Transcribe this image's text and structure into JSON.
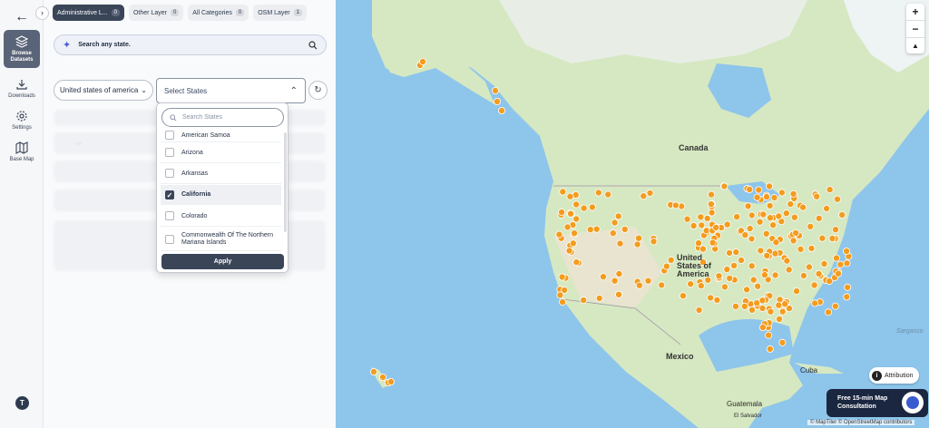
{
  "rail": {
    "back_icon": "arrow-left-icon",
    "items": [
      {
        "label": "Browse Datasets",
        "icon": "layers-icon",
        "active": true
      },
      {
        "label": "Downloads",
        "icon": "download-icon"
      },
      {
        "label": "Settings",
        "icon": "gear-icon"
      },
      {
        "label": "Base Map",
        "icon": "map-icon"
      }
    ],
    "avatar_initial": "T"
  },
  "tabs": [
    {
      "label": "Administrative L...",
      "count": "0",
      "active": true
    },
    {
      "label": "Other Layer",
      "count": "0"
    },
    {
      "label": "All Categories",
      "count": "0"
    },
    {
      "label": "OSM Layer",
      "count": "1"
    }
  ],
  "search": {
    "placeholder": "Search any state."
  },
  "filters": {
    "country": "United states of america",
    "states_placeholder": "Select States"
  },
  "dropdown": {
    "search_placeholder": "Search States",
    "items": [
      {
        "label": "American Samoa",
        "checked": false
      },
      {
        "label": "Arizona",
        "checked": false
      },
      {
        "label": "Arkansas",
        "checked": false
      },
      {
        "label": "California",
        "checked": true
      },
      {
        "label": "Colorado",
        "checked": false
      },
      {
        "label": "Commonwealth Of The Northern Mariana Islands",
        "checked": false
      }
    ],
    "apply_label": "Apply"
  },
  "map": {
    "labels": {
      "canada": "Canada",
      "usa": "United States of America",
      "mexico": "Mexico",
      "cuba": "Cuba",
      "guatemala": "Guatemala",
      "el_salvador": "El Salvador",
      "sargasso": "Sargasso"
    },
    "zoom_in": "+",
    "zoom_out": "−",
    "compass": "▲",
    "attribution_label": "Attribution",
    "consult_line1": "Free 15-min Map",
    "consult_line2": "Consultation",
    "footer": "© MapTiler © OpenStreetMap contributors",
    "marker_color": "#f39c1f",
    "water_color": "#8ec5eb",
    "land_color": "#d6e8c2"
  }
}
